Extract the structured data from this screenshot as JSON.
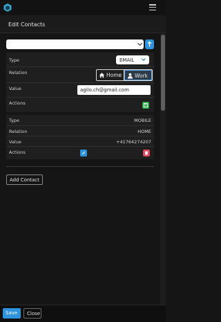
{
  "header": {
    "title": "Edit Contacts"
  },
  "contacts_editor": {
    "type_label": "Type",
    "relation_label": "Relation",
    "value_label": "Value",
    "actions_label": "Actions",
    "type_value": "EMAIL",
    "relation_options": [
      "Home",
      "Work"
    ],
    "relation_selected": "Work",
    "value": "agilo.ch@gmail.com"
  },
  "contact_row": {
    "type_label": "Type",
    "relation_label": "Relation",
    "value_label": "Value",
    "actions_label": "Actions",
    "type_value": "MOBILE",
    "relation_value": "HOME",
    "value": "+41764274207"
  },
  "buttons": {
    "add_contact": "Add Contact",
    "save": "Save",
    "close": "Close"
  },
  "icons": {
    "logo": "cube-logo-icon",
    "menu": "hamburger-menu-icon",
    "add": "arrow-up-icon",
    "home": "home-icon",
    "work": "person-icon",
    "save_small": "save-icon",
    "edit": "pencil-icon",
    "delete": "trash-icon"
  },
  "colors": {
    "accent": "#2f93db",
    "success": "#2fb24a",
    "danger": "#e0455c"
  }
}
